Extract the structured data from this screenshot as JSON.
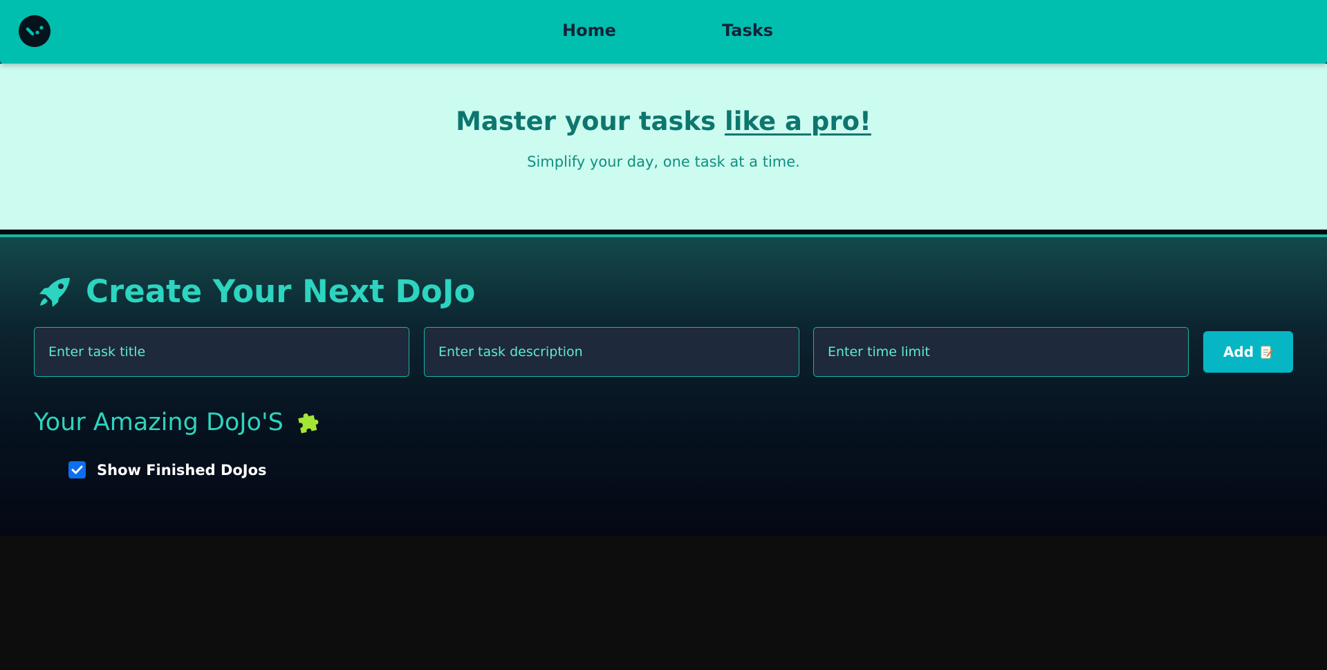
{
  "navbar": {
    "logo_icon": "logo-icon",
    "links": [
      {
        "label": "Home"
      },
      {
        "label": "Tasks"
      }
    ],
    "background": "#00bfae"
  },
  "hero": {
    "title_prefix": "Master your tasks ",
    "title_highlight": "like a pro!",
    "subtitle": "Simplify your day, one task at a time."
  },
  "create": {
    "icon": "rocket-icon",
    "title": "Create Your Next DoJo",
    "inputs": {
      "title_placeholder": "Enter task title",
      "description_placeholder": "Enter task description",
      "time_placeholder": "Enter time limit"
    },
    "add_label": "Add",
    "add_icon": "memo-icon"
  },
  "list": {
    "title": "Your Amazing DoJo'S",
    "icon": "puzzle-icon",
    "show_finished_label": "Show Finished DoJos",
    "show_finished_checked": true
  },
  "colors": {
    "accent": "#2dd4bf",
    "button": "#06b6c4",
    "checkbox": "#0b6ff0"
  }
}
